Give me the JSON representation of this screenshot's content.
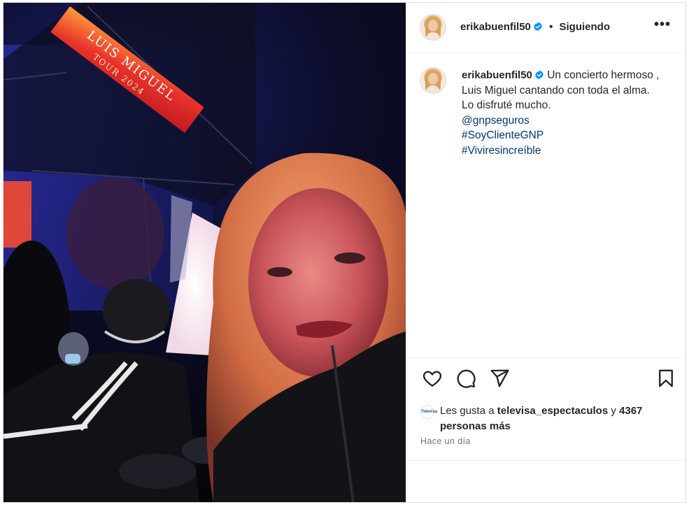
{
  "post": {
    "username": "erikabuenfil50",
    "separator": "•",
    "follow_status": "Siguiendo",
    "more_label": "•••",
    "caption_text": "Un concierto hermoso , Luis Miguel cantando con toda el alma. Lo disfruté mucho.",
    "mention": "@gnpseguros",
    "hashtags": [
      "#SoyClienteGNP",
      "#Viviresincreíble"
    ],
    "photo_sign": {
      "line1": "LUIS MIGUEL",
      "line2": "TOUR 2024"
    }
  },
  "likes": {
    "prefix": "Les gusta a ",
    "user": "televisa_espectaculos",
    "middle": " y ",
    "others": "4367 personas más",
    "mini_avatar_text": "Televisa"
  },
  "timestamp": "Hace un día",
  "icons": {
    "verified": "verified-badge-icon",
    "like": "heart-icon",
    "comment": "comment-bubble-icon",
    "share": "paper-plane-icon",
    "save": "bookmark-icon",
    "more": "more-dots-icon"
  },
  "colors": {
    "verified": "#0095f6",
    "link": "#00376b",
    "muted": "#737373"
  }
}
